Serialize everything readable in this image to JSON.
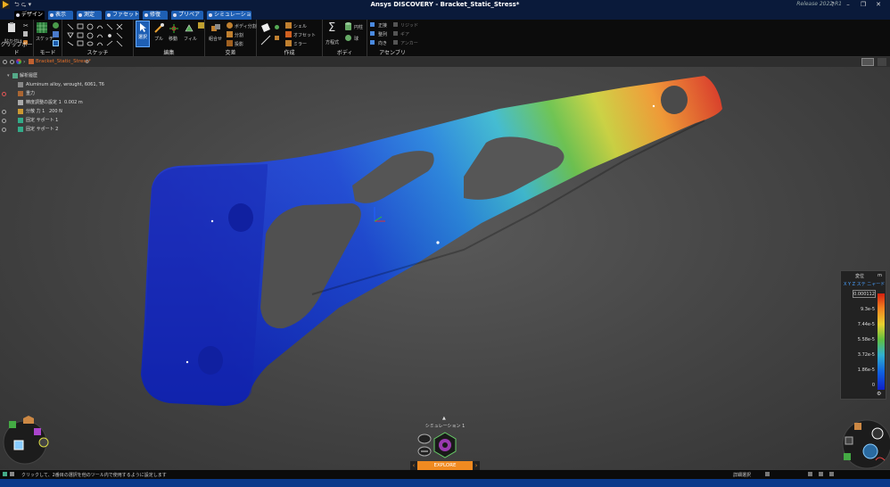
{
  "app": {
    "title": "Ansys DISCOVERY - Bracket_Static_Stress*",
    "release": "Release 2022 R1",
    "quick_access": "⮌ ⮎ ▾",
    "window_controls": [
      "?",
      "–",
      "❐",
      "✕"
    ]
  },
  "tabs": [
    {
      "label": "デザイン",
      "active": true
    },
    {
      "label": "表示",
      "active": false
    },
    {
      "label": "測定",
      "active": false
    },
    {
      "label": "ファセット",
      "active": false
    },
    {
      "label": "修復",
      "active": false
    },
    {
      "label": "プリペア",
      "active": false
    },
    {
      "label": "シミュレーション",
      "active": false
    }
  ],
  "ribbon": {
    "groups": [
      {
        "label": "クリップボード"
      },
      {
        "label": "モード"
      },
      {
        "label": "スケッチ"
      },
      {
        "label": "編集"
      },
      {
        "label": "交差"
      },
      {
        "label": "作成"
      },
      {
        "label": "ボディ"
      },
      {
        "label": "アセンブリ"
      }
    ],
    "clipboard": {
      "paste": "貼り付け"
    },
    "mode": {
      "sketch": "スケッチ"
    },
    "edit": {
      "select": "選択",
      "pull": "プル",
      "move": "移動",
      "fill": "フィル"
    },
    "intersect": {
      "combine": "組合せ",
      "split_body": "ボディ分割",
      "split": "分割",
      "project": "投影"
    },
    "create": {
      "shell": "シェル",
      "offset": "オフセット",
      "mirror": "ミラー"
    },
    "body": {
      "equation": "方程式",
      "cylinder": "円柱",
      "sphere": "球"
    },
    "assembly": {
      "tangent": "正接",
      "align": "整列",
      "orient": "向き",
      "rigid": "リジッド",
      "gear": "ギア",
      "anchor": "アンカー"
    }
  },
  "document": {
    "name": "Bracket_Static_Stress*"
  },
  "tree": {
    "items": [
      {
        "label": "解析履歴"
      },
      {
        "label": "Aluminum alloy, wrought, 6061, T6"
      },
      {
        "label": "重力"
      },
      {
        "label": "精度調整の設定 1",
        "value": "0.002 m"
      },
      {
        "label": "分散 力 1",
        "value": "200 N"
      },
      {
        "label": "固定 サポート 1"
      },
      {
        "label": "固定 サポート 2"
      }
    ]
  },
  "legend": {
    "title": "変位",
    "unit": "m",
    "axes": "X  Y  Z  ステ ニャード",
    "max": "0.000112",
    "ticks": [
      "9.3e-5",
      "7.44e-5",
      "5.58e-5",
      "3.72e-5",
      "1.86e-5",
      "0"
    ]
  },
  "simulation": {
    "label": "シミュレーション 1",
    "explore": "EXPLORE"
  },
  "status": {
    "hint": "クリックして、2番目の選択を他のツール内で使用するように設定します",
    "selection": "詳細選択"
  },
  "colors": {
    "accent_orange": "#f08a20",
    "tab_blue": "#1e5fb4",
    "title_bg": "#0a1a3a",
    "status_blue": "#0b3a8a"
  }
}
